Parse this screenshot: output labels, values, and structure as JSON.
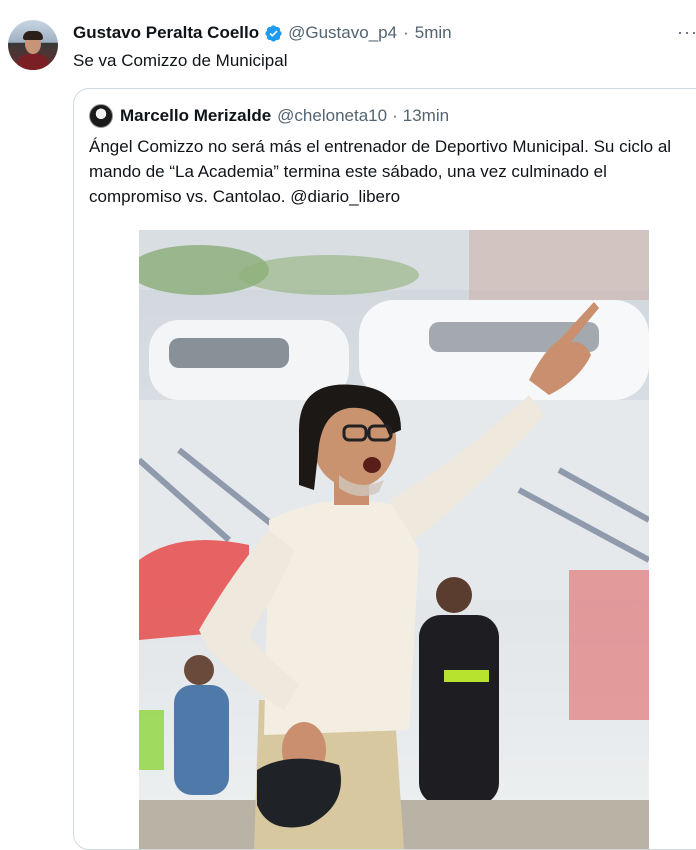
{
  "tweet": {
    "author_name": "Gustavo Peralta Coello",
    "handle": "@Gustavo_p4",
    "separator": "·",
    "time": "5min",
    "text": "Se va Comizzo de Municipal",
    "more_label": "···"
  },
  "quoted": {
    "author_name": "Marcello Merizalde",
    "handle": "@cheloneta10",
    "separator": "·",
    "time": "13min",
    "text": "Ángel Comizzo no será más el entrenador de Deportivo Municipal. Su ciclo al mando de “La Academia” termina este sábado, una vez culminado el compromiso vs. Cantolao. ",
    "mention": "@diario_libero"
  },
  "colors": {
    "verified": "#1d9bf0",
    "secondary_text": "#536471",
    "border": "#cfd9de"
  },
  "icons": {
    "verified": "verified-badge-icon",
    "more": "more-icon"
  }
}
